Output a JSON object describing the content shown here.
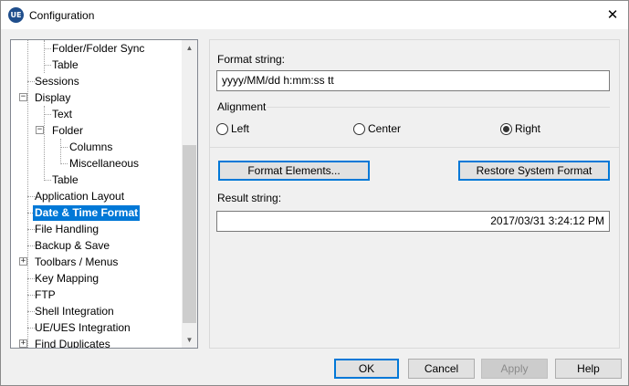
{
  "window": {
    "title": "Configuration",
    "app_icon": "UE",
    "close_glyph": "✕"
  },
  "tree": {
    "items": [
      {
        "label": "Folder/Folder Sync"
      },
      {
        "label": "Table"
      },
      {
        "label": "Sessions"
      },
      {
        "label": "Display"
      },
      {
        "label": "Text"
      },
      {
        "label": "Folder"
      },
      {
        "label": "Columns"
      },
      {
        "label": "Miscellaneous"
      },
      {
        "label": "Table"
      },
      {
        "label": "Application Layout"
      },
      {
        "label": "Date & Time Format"
      },
      {
        "label": "File Handling"
      },
      {
        "label": "Backup & Save"
      },
      {
        "label": "Toolbars / Menus"
      },
      {
        "label": "Key Mapping"
      },
      {
        "label": "FTP"
      },
      {
        "label": "Shell Integration"
      },
      {
        "label": "UE/UES Integration"
      },
      {
        "label": "Find Duplicates"
      }
    ],
    "expand_minus": "−",
    "expand_plus": "+",
    "scroll_up": "▲",
    "scroll_down": "▼"
  },
  "format": {
    "format_string_label": "Format string:",
    "format_string_value": "yyyy/MM/dd h:mm:ss tt",
    "alignment_label": "Alignment",
    "radio_left": "Left",
    "radio_center": "Center",
    "radio_right": "Right",
    "format_elements_button": "Format Elements...",
    "restore_button": "Restore System Format",
    "result_label": "Result string:",
    "result_value": "2017/03/31 3:24:12 PM"
  },
  "footer": {
    "ok": "OK",
    "cancel": "Cancel",
    "apply": "Apply",
    "help": "Help"
  }
}
